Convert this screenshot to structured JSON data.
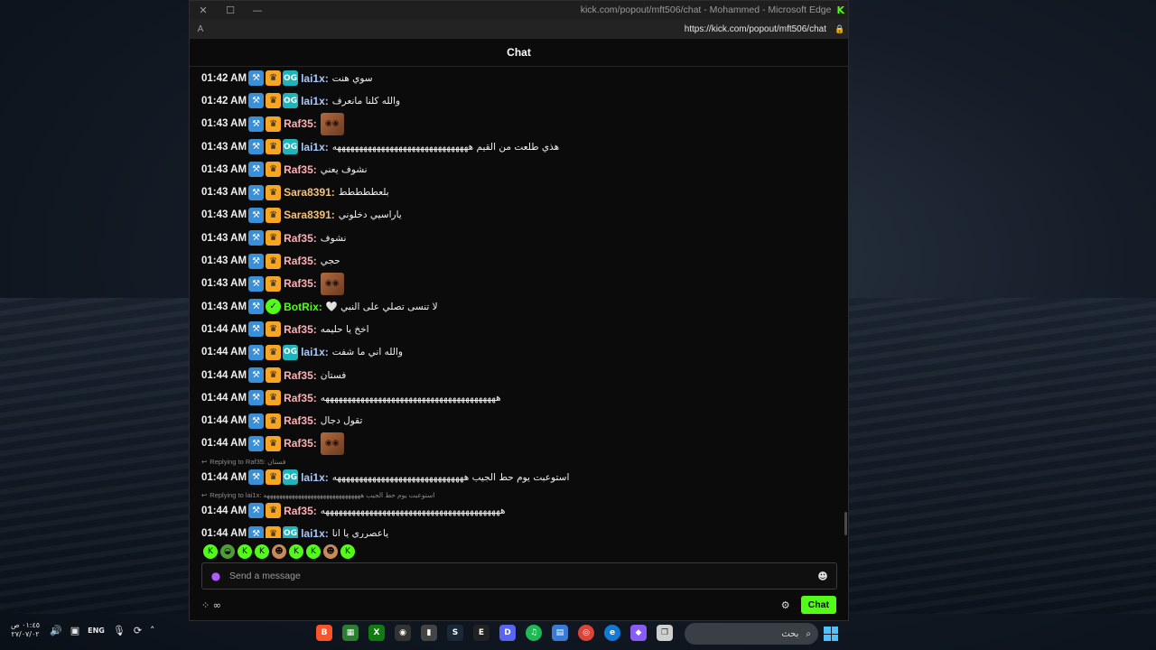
{
  "window": {
    "title": "kick.com/popout/mft506/chat - Mohammed - Microsoft Edge",
    "url": "https://kick.com/popout/mft506/chat",
    "reader_icon": "A",
    "chat_title": "Chat"
  },
  "messages": [
    {
      "time": "01:42 AM",
      "badges": [
        "hammer",
        "crown",
        "og"
      ],
      "user": "lai1x",
      "color": "#a9c8ff",
      "text": "سوي هنت"
    },
    {
      "time": "01:42 AM",
      "badges": [
        "hammer",
        "crown",
        "og"
      ],
      "user": "lai1x",
      "color": "#a9c8ff",
      "text": "والله كلنا مانعرف"
    },
    {
      "time": "01:43 AM",
      "badges": [
        "hammer",
        "crown"
      ],
      "user": "Raf35",
      "color": "#ffb0b5",
      "emote": true
    },
    {
      "time": "01:43 AM",
      "badges": [
        "hammer",
        "crown",
        "og"
      ],
      "user": "lai1x",
      "color": "#a9c8ff",
      "text": "هذي طلعت من القيم هههههههههههههههههههههههههههههههه"
    },
    {
      "time": "01:43 AM",
      "badges": [
        "hammer",
        "crown"
      ],
      "user": "Raf35",
      "color": "#ffb0b5",
      "text": "نشوف يعني"
    },
    {
      "time": "01:43 AM",
      "badges": [
        "hammer",
        "crown"
      ],
      "user": "Sara8391",
      "color": "#f6c27a",
      "text": "بلعططططط"
    },
    {
      "time": "01:43 AM",
      "badges": [
        "hammer",
        "crown"
      ],
      "user": "Sara8391",
      "color": "#f6c27a",
      "text": "ياراسيي دخلوني"
    },
    {
      "time": "01:43 AM",
      "badges": [
        "hammer",
        "crown"
      ],
      "user": "Raf35",
      "color": "#ffb0b5",
      "text": "نشوف"
    },
    {
      "time": "01:43 AM",
      "badges": [
        "hammer",
        "crown"
      ],
      "user": "Raf35",
      "color": "#ffb0b5",
      "text": "حجي"
    },
    {
      "time": "01:43 AM",
      "badges": [
        "hammer",
        "crown"
      ],
      "user": "Raf35",
      "color": "#ffb0b5",
      "emote": true
    },
    {
      "time": "01:43 AM",
      "badges": [
        "hammer",
        "bot"
      ],
      "user": "BotRix",
      "color": "#53fc18",
      "text": "لا تنسى تصلي على النبي 🤍"
    },
    {
      "time": "01:44 AM",
      "badges": [
        "hammer",
        "crown"
      ],
      "user": "Raf35",
      "color": "#ffb0b5",
      "text": "اخخ يا حليمه"
    },
    {
      "time": "01:44 AM",
      "badges": [
        "hammer",
        "crown",
        "og"
      ],
      "user": "lai1x",
      "color": "#a9c8ff",
      "text": "والله اني ما شفت"
    },
    {
      "time": "01:44 AM",
      "badges": [
        "hammer",
        "crown"
      ],
      "user": "Raf35",
      "color": "#ffb0b5",
      "text": "فستان"
    },
    {
      "time": "01:44 AM",
      "badges": [
        "hammer",
        "crown"
      ],
      "user": "Raf35",
      "color": "#ffb0b5",
      "text": "ههههههههههههههههههههههههههههههههههههههههه"
    },
    {
      "time": "01:44 AM",
      "badges": [
        "hammer",
        "crown"
      ],
      "user": "Raf35",
      "color": "#ffb0b5",
      "text": "تقول دجال"
    },
    {
      "time": "01:44 AM",
      "badges": [
        "hammer",
        "crown"
      ],
      "user": "Raf35",
      "color": "#ffb0b5",
      "emote": true
    },
    {
      "reply": "Replying to Raf35: فستان",
      "time": "01:44 AM",
      "badges": [
        "hammer",
        "crown",
        "og"
      ],
      "user": "lai1x",
      "color": "#a9c8ff",
      "text": "استوعبت يوم حط الجيب ههههههههههههههههههههههههههههههه"
    },
    {
      "reply": "Replying to lai1x: استوعبت يوم حط الجيب هههههههههههههههههههههههههههههههه",
      "time": "01:44 AM",
      "badges": [
        "hammer",
        "crown"
      ],
      "user": "Raf35",
      "color": "#ffb0b5",
      "text": "هههههههههههههههههههههههههههههههههههههههههه"
    },
    {
      "time": "01:44 AM",
      "badges": [
        "hammer",
        "crown",
        "og"
      ],
      "user": "lai1x",
      "color": "#a9c8ff",
      "text": "ياعصرري يا انا"
    }
  ],
  "emote_bar": [
    "kick-icon",
    "frog-icon",
    "kick-icon",
    "kick-icon",
    "face-icon",
    "kick-icon",
    "kick-icon",
    "face-icon",
    "kick-icon"
  ],
  "input": {
    "placeholder": "Send a message"
  },
  "send_label": "Chat",
  "taskbar": {
    "time": "٠١:٤٥ ص",
    "date": "٢٧/٠٧/٠٢",
    "lang": "ENG",
    "search": "بحث"
  }
}
